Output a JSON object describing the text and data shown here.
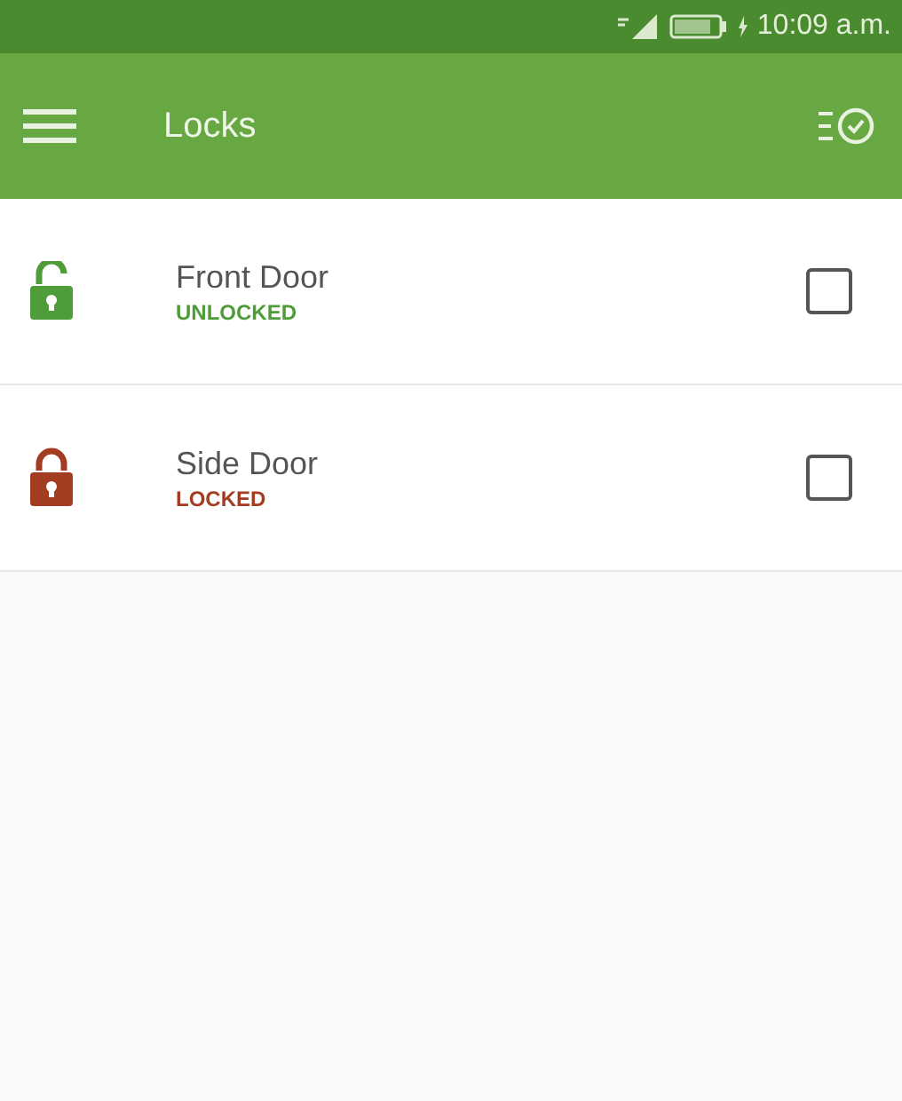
{
  "status_bar": {
    "time": "10:09 a.m."
  },
  "app_bar": {
    "title": "Locks"
  },
  "locks": [
    {
      "name": "Front Door",
      "status": "UNLOCKED",
      "locked": false,
      "checked": false
    },
    {
      "name": "Side Door",
      "status": "LOCKED",
      "locked": true,
      "checked": false
    }
  ]
}
